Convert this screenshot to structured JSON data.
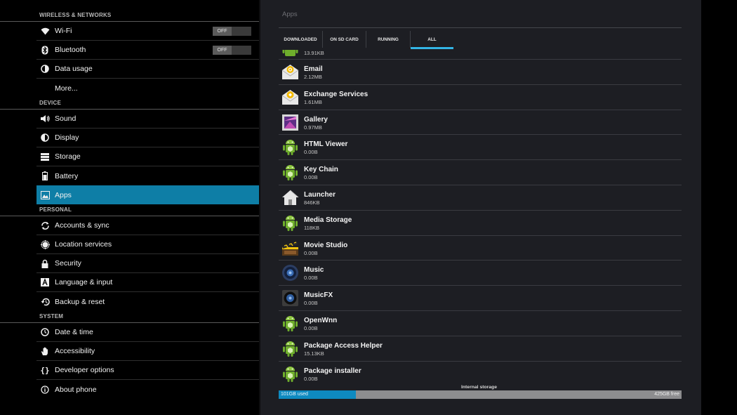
{
  "settings": {
    "sections": {
      "wireless": "WIRELESS & NETWORKS",
      "device": "DEVICE",
      "personal": "PERSONAL",
      "system": "SYSTEM"
    },
    "items": {
      "wifi": "Wi-Fi",
      "bluetooth": "Bluetooth",
      "data_usage": "Data usage",
      "more": "More...",
      "sound": "Sound",
      "display": "Display",
      "storage": "Storage",
      "battery": "Battery",
      "apps": "Apps",
      "accounts": "Accounts & sync",
      "location": "Location services",
      "security": "Security",
      "language": "Language & input",
      "backup": "Backup & reset",
      "datetime": "Date & time",
      "accessibility": "Accessibility",
      "developer": "Developer options",
      "about": "About phone"
    },
    "wifi_toggle": "OFF",
    "bluetooth_toggle": "OFF",
    "selected": "apps",
    "accent_color": "#33b5e5"
  },
  "apps_panel": {
    "title": "Apps",
    "tabs": [
      "DOWNLOADED",
      "ON SD CARD",
      "RUNNING",
      "ALL"
    ],
    "active_tab": "ALL",
    "apps": [
      {
        "name": "",
        "size": "13.91KB",
        "icon": "android-icon"
      },
      {
        "name": "Email",
        "size": "2.12MB",
        "icon": "email-icon"
      },
      {
        "name": "Exchange Services",
        "size": "1.61MB",
        "icon": "exchange-icon"
      },
      {
        "name": "Gallery",
        "size": "0.97MB",
        "icon": "gallery-icon"
      },
      {
        "name": "HTML Viewer",
        "size": "0.00B",
        "icon": "android-icon"
      },
      {
        "name": "Key Chain",
        "size": "0.00B",
        "icon": "android-icon"
      },
      {
        "name": "Launcher",
        "size": "846KB",
        "icon": "launcher-icon"
      },
      {
        "name": "Media Storage",
        "size": "118KB",
        "icon": "android-icon"
      },
      {
        "name": "Movie Studio",
        "size": "0.00B",
        "icon": "movie-studio-icon"
      },
      {
        "name": "Music",
        "size": "0.00B",
        "icon": "music-icon"
      },
      {
        "name": "MusicFX",
        "size": "0.00B",
        "icon": "musicfx-icon"
      },
      {
        "name": "OpenWnn",
        "size": "0.00B",
        "icon": "android-icon"
      },
      {
        "name": "Package Access Helper",
        "size": "15.13KB",
        "icon": "android-icon"
      },
      {
        "name": "Package installer",
        "size": "0.00B",
        "icon": "android-icon"
      }
    ],
    "storage": {
      "label": "Internal storage",
      "used": "101GB used",
      "free": "425GB free",
      "used_fraction": 0.192
    }
  }
}
